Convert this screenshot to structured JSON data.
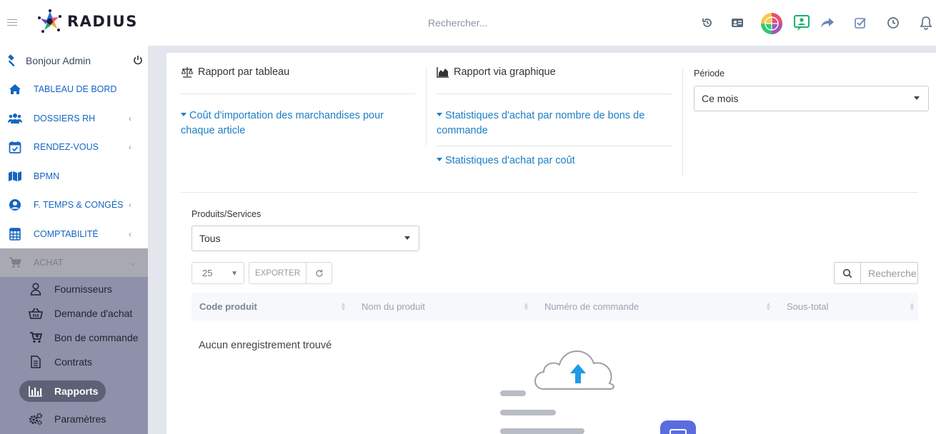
{
  "app": {
    "logo_text": "RADIUS"
  },
  "header": {
    "search_placeholder": "Rechercher...",
    "icons": [
      "history-icon",
      "id-card-icon",
      "app-globe-icon",
      "chat-user-icon",
      "share-icon",
      "checklist-icon",
      "clock-icon",
      "bell-icon"
    ]
  },
  "sidebar": {
    "greeting": "Bonjour Admin",
    "items": [
      {
        "label": "TABLEAU DE BORD",
        "icon": "home-icon"
      },
      {
        "label": "DOSSIERS RH",
        "icon": "users-icon",
        "chevron": "‹"
      },
      {
        "label": "RENDEZ-VOUS",
        "icon": "calendar-check-icon",
        "chevron": "‹"
      },
      {
        "label": "BPMN",
        "icon": "map-icon"
      },
      {
        "label": "F. TEMPS & CONGÉS",
        "icon": "user-circle-icon",
        "chevron": "‹"
      },
      {
        "label": "COMPTABILITÉ",
        "icon": "calculator-icon",
        "chevron": "‹"
      },
      {
        "label": "ACHAT",
        "icon": "cart-icon",
        "chevron": "⌄"
      }
    ],
    "achat_submenu": [
      {
        "label": "Fournisseurs",
        "icon": "user-outline-icon"
      },
      {
        "label": "Demande d'achat",
        "icon": "basket-icon"
      },
      {
        "label": "Bon de commande",
        "icon": "cart-plus-icon"
      },
      {
        "label": "Contrats",
        "icon": "document-icon"
      },
      {
        "label": "Rapports",
        "icon": "bar-chart-icon",
        "active": true
      },
      {
        "label": "Paramètres",
        "icon": "gears-icon"
      }
    ]
  },
  "reports": {
    "table_title": "Rapport par tableau",
    "table_links": [
      "Coût d'importation des marchandises pour chaque article"
    ],
    "chart_title": "Rapport via graphique",
    "chart_links": [
      "Statistiques d'achat par nombre de bons de commande",
      "Statistiques d'achat par coût"
    ],
    "period_label": "Période",
    "period_value": "Ce mois"
  },
  "filters": {
    "products_label": "Produits/Services",
    "products_value": "Tous"
  },
  "table": {
    "page_size": "25",
    "export_label": "EXPORTER",
    "search_placeholder": "Recherche",
    "columns": [
      "Code produit",
      "Nom du produit",
      "Numéro de commande",
      "Sous-total"
    ],
    "empty_text": "Aucun enregistrement trouvé"
  },
  "colors": {
    "accent": "#1565c0",
    "link": "#1c7fc4",
    "sidebar_active": "#8e91a9",
    "upload_arrow": "#1e9be9"
  }
}
